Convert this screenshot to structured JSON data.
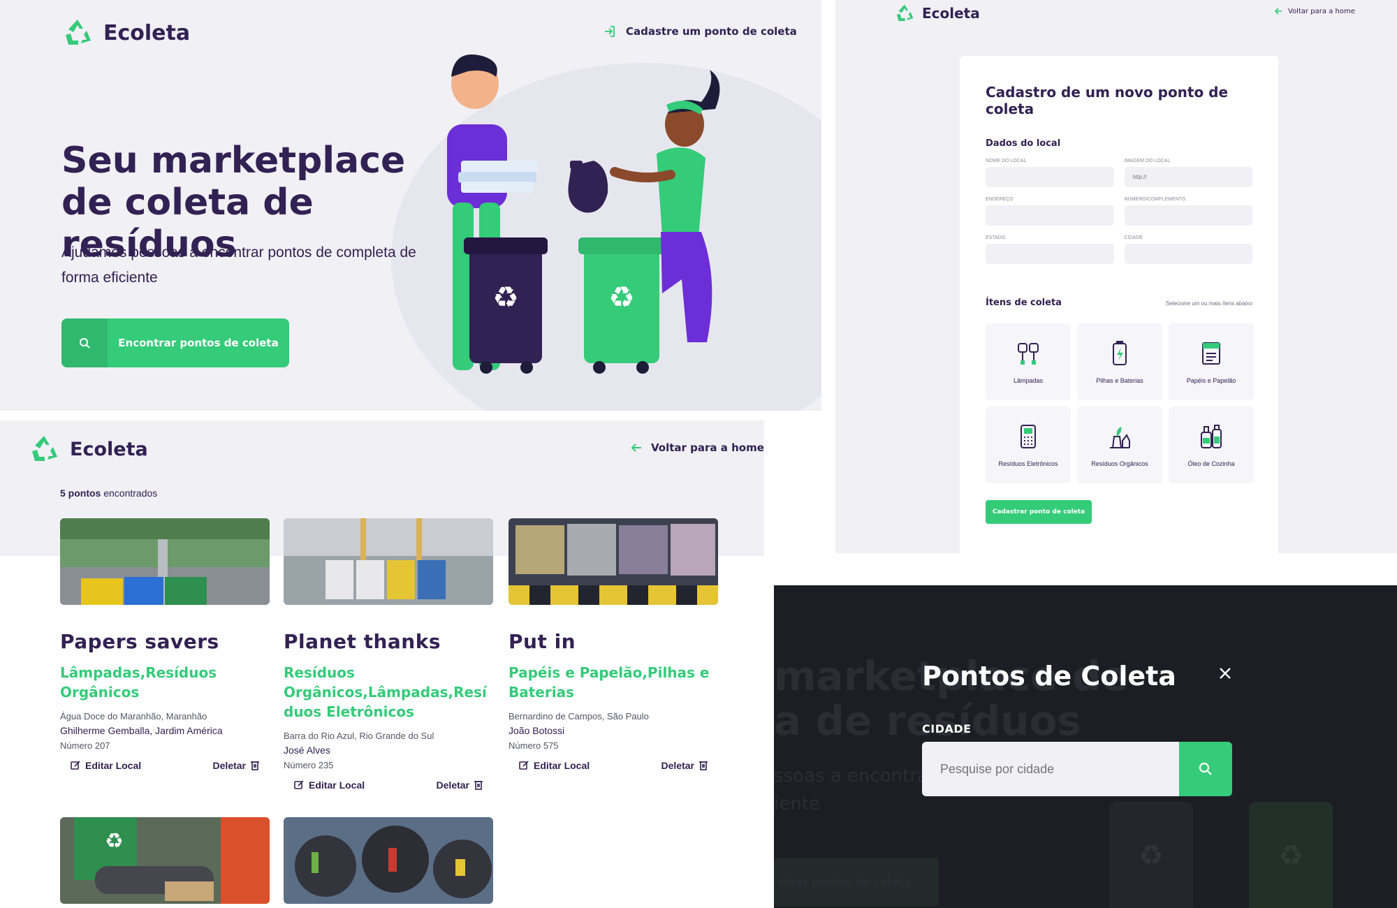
{
  "colors": {
    "primary": "#34cb79",
    "title": "#322153",
    "background": "#f0f0f5",
    "overlay": "#1d1d24"
  },
  "home": {
    "logo_text": "Ecoleta",
    "register_link": "Cadastre um ponto de coleta",
    "headline": "Seu marketplace de coleta de resíduos",
    "lead": "Ajudamos pessoas a encontrar pontos de completa de forma eficiente",
    "find_button": "Encontrar pontos de coleta"
  },
  "create_point": {
    "logo_text": "Ecoleta",
    "back_link": "Voltar para a home",
    "title": "Cadastro de um novo ponto de coleta",
    "section_place": "Dados do local",
    "fields": {
      "name_label": "NOME DO LOCAL",
      "image_label": "IMAGEM DO LOCAL",
      "image_placeholder": "http://",
      "address_label": "ENDEREÇO",
      "number_label": "NÚMERO/COMPLEMENTO",
      "state_label": "ESTADO",
      "city_label": "CIDADE"
    },
    "section_items": "Ítens de coleta",
    "items_hint": "Selecione um ou mais ítens abaixo",
    "items": [
      {
        "label": "Lâmpadas",
        "icon": "lamps-icon"
      },
      {
        "label": "Pilhas e Baterias",
        "icon": "battery-icon"
      },
      {
        "label": "Papéis e Papelão",
        "icon": "paper-icon"
      },
      {
        "label": "Resíduos Eletrônicos",
        "icon": "electronics-icon"
      },
      {
        "label": "Resíduos Orgânicos",
        "icon": "organic-icon"
      },
      {
        "label": "Óleo de Cozinha",
        "icon": "oil-icon"
      }
    ],
    "submit": "Cadastrar ponto de coleta"
  },
  "points_list": {
    "logo_text": "Ecoleta",
    "back_link": "Voltar para a home",
    "count_number": "5 pontos",
    "count_suffix": " encontrados",
    "edit_label": "Editar Local",
    "delete_label": "Deletar",
    "points": [
      {
        "name": "Papers savers",
        "items": "Lâmpadas,Resíduos Orgânicos",
        "city_line": "Água Doce do Maranhão, Maranhão",
        "address_line": "Ghilherme Gemballa, Jardim América",
        "number_line": "Número 207"
      },
      {
        "name": "Planet thanks",
        "items": "Resíduos Orgânicos,Lâmpadas,Resíduos Eletrônicos",
        "city_line": "Barra do Rio Azul, Rio Grande do Sul",
        "address_line": "José Alves",
        "number_line": "Número 235"
      },
      {
        "name": "Put in",
        "items": "Papéis e Papelão,Pilhas e Baterias",
        "city_line": "Bernardino de Campos, São Paulo",
        "address_line": "João Botossi",
        "number_line": "Número 575"
      }
    ]
  },
  "modal": {
    "title": "Pontos de Coleta",
    "city_label": "CIDADE",
    "search_placeholder": "Pesquise por cidade",
    "bg_headline_1": "marketplace de",
    "bg_headline_2": "a de resíduos",
    "bg_lead_1": "ssoas a encontrar",
    "bg_lead_2": "iente",
    "bg_button": "ntrar pontos de coleta"
  }
}
